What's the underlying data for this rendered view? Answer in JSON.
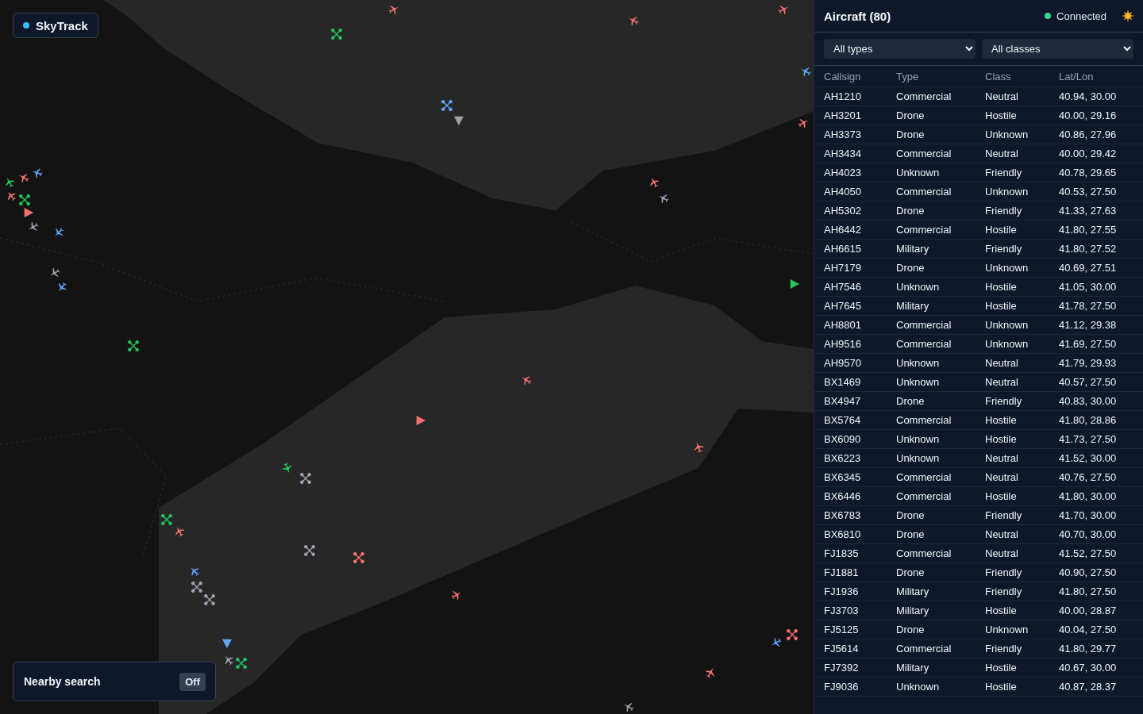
{
  "app": {
    "name": "SkyTrack"
  },
  "map_markers": [
    {
      "kind": "plane",
      "color": "#22c55e"
    },
    {
      "kind": "plane",
      "color": "#f87171"
    },
    {
      "kind": "plane",
      "color": "#60a5fa"
    },
    {
      "kind": "plane",
      "color": "#f87171"
    },
    {
      "kind": "drone",
      "color": "#22c55e"
    },
    {
      "kind": "triangle",
      "color": "#f87171"
    },
    {
      "kind": "plane",
      "color": "#9ca3af"
    },
    {
      "kind": "plane",
      "color": "#60a5fa"
    },
    {
      "kind": "plane",
      "color": "#9ca3af"
    },
    {
      "kind": "plane",
      "color": "#60a5fa"
    },
    {
      "kind": "drone",
      "color": "#22c55e"
    },
    {
      "kind": "plane",
      "color": "#f87171"
    },
    {
      "kind": "drone",
      "color": "#22c55e"
    },
    {
      "kind": "plane",
      "color": "#f87171"
    },
    {
      "kind": "plane",
      "color": "#f87171"
    },
    {
      "kind": "drone",
      "color": "#60a5fa"
    },
    {
      "kind": "triangle",
      "color": "#9ca3af"
    },
    {
      "kind": "plane",
      "color": "#f87171"
    },
    {
      "kind": "plane",
      "color": "#f87171"
    },
    {
      "kind": "plane",
      "color": "#9ca3af"
    },
    {
      "kind": "triangle",
      "color": "#22c55e"
    },
    {
      "kind": "plane",
      "color": "#f87171"
    },
    {
      "kind": "triangle",
      "color": "#f87171"
    },
    {
      "kind": "plane",
      "color": "#f87171"
    },
    {
      "kind": "plane",
      "color": "#22c55e"
    },
    {
      "kind": "drone",
      "color": "#9ca3af"
    },
    {
      "kind": "drone",
      "color": "#22c55e"
    },
    {
      "kind": "plane",
      "color": "#f87171"
    },
    {
      "kind": "drone",
      "color": "#9ca3af"
    },
    {
      "kind": "drone",
      "color": "#f87171"
    },
    {
      "kind": "plane",
      "color": "#60a5fa"
    },
    {
      "kind": "drone",
      "color": "#9ca3af"
    },
    {
      "kind": "drone",
      "color": "#9ca3af"
    },
    {
      "kind": "plane",
      "color": "#f87171"
    },
    {
      "kind": "triangle",
      "color": "#60a5fa"
    },
    {
      "kind": "plane",
      "color": "#9ca3af"
    },
    {
      "kind": "drone",
      "color": "#22c55e"
    },
    {
      "kind": "plane",
      "color": "#60a5fa"
    },
    {
      "kind": "drone",
      "color": "#f87171"
    },
    {
      "kind": "plane",
      "color": "#f87171"
    },
    {
      "kind": "plane",
      "color": "#9ca3af"
    },
    {
      "kind": "plane",
      "color": "#60a5fa"
    }
  ],
  "nearby_search": {
    "label": "Nearby search",
    "value": "Off",
    "on": false
  },
  "panel": {
    "title": "Aircraft (80)",
    "status": {
      "label": "Connected",
      "connected": true
    },
    "filters": [
      {
        "value": "All types"
      },
      {
        "value": "All classes"
      }
    ],
    "columns": [
      "Callsign",
      "Type",
      "Class",
      "Lat/Lon"
    ],
    "rows": [
      [
        "AH1210",
        "Commercial",
        "Neutral",
        "40.94, 30.00"
      ],
      [
        "AH3201",
        "Drone",
        "Hostile",
        "40.00, 29.16"
      ],
      [
        "AH3373",
        "Drone",
        "Unknown",
        "40.86, 27.96"
      ],
      [
        "AH3434",
        "Commercial",
        "Neutral",
        "40.00, 29.42"
      ],
      [
        "AH4023",
        "Unknown",
        "Friendly",
        "40.78, 29.65"
      ],
      [
        "AH4050",
        "Commercial",
        "Unknown",
        "40.53, 27.50"
      ],
      [
        "AH5302",
        "Drone",
        "Friendly",
        "41.33, 27.63"
      ],
      [
        "AH6442",
        "Commercial",
        "Hostile",
        "41.80, 27.55"
      ],
      [
        "AH6615",
        "Military",
        "Friendly",
        "41.80, 27.52"
      ],
      [
        "AH7179",
        "Drone",
        "Unknown",
        "40.69, 27.51"
      ],
      [
        "AH7546",
        "Unknown",
        "Hostile",
        "41.05, 30.00"
      ],
      [
        "AH7645",
        "Military",
        "Hostile",
        "41.78, 27.50"
      ],
      [
        "AH8801",
        "Commercial",
        "Unknown",
        "41.12, 29.38"
      ],
      [
        "AH9516",
        "Commercial",
        "Unknown",
        "41.69, 27.50"
      ],
      [
        "AH9570",
        "Unknown",
        "Neutral",
        "41.79, 29.93"
      ],
      [
        "BX1469",
        "Unknown",
        "Neutral",
        "40.57, 27.50"
      ],
      [
        "BX4947",
        "Drone",
        "Friendly",
        "40.83, 30.00"
      ],
      [
        "BX5764",
        "Commercial",
        "Hostile",
        "41.80, 28.86"
      ],
      [
        "BX6090",
        "Unknown",
        "Hostile",
        "41.73, 27.50"
      ],
      [
        "BX6223",
        "Unknown",
        "Neutral",
        "41.52, 30.00"
      ],
      [
        "BX6345",
        "Commercial",
        "Neutral",
        "40.76, 27.50"
      ],
      [
        "BX6446",
        "Commercial",
        "Hostile",
        "41.80, 30.00"
      ],
      [
        "BX6783",
        "Drone",
        "Friendly",
        "41.70, 30.00"
      ],
      [
        "BX6810",
        "Drone",
        "Neutral",
        "40.70, 30.00"
      ],
      [
        "FJ1835",
        "Commercial",
        "Neutral",
        "41.52, 27.50"
      ],
      [
        "FJ1881",
        "Drone",
        "Friendly",
        "40.90, 27.50"
      ],
      [
        "FJ1936",
        "Military",
        "Friendly",
        "41.80, 27.50"
      ],
      [
        "FJ3703",
        "Military",
        "Hostile",
        "40.00, 28.87"
      ],
      [
        "FJ5125",
        "Drone",
        "Unknown",
        "40.04, 27.50"
      ],
      [
        "FJ5614",
        "Commercial",
        "Friendly",
        "41.80, 29.77"
      ],
      [
        "FJ7392",
        "Military",
        "Hostile",
        "40.67, 30.00"
      ],
      [
        "FJ9036",
        "Unknown",
        "Hostile",
        "40.87, 28.37"
      ]
    ]
  }
}
